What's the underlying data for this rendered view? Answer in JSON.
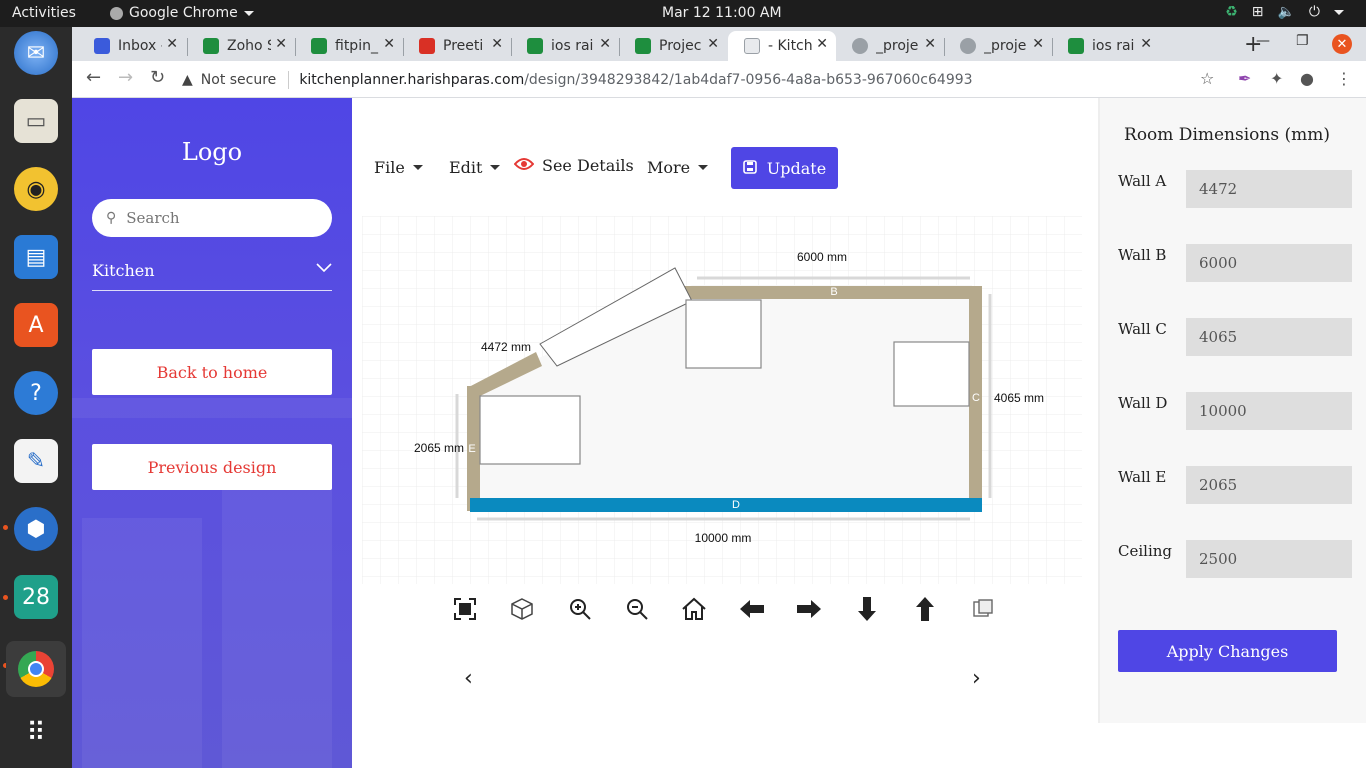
{
  "system": {
    "activities": "Activities",
    "app_name": "Google Chrome",
    "clock": "Mar 12  11:00 AM",
    "calendar_day": "28"
  },
  "browser": {
    "tabs": [
      {
        "label": "Inbox -",
        "color": "#3b5bdb"
      },
      {
        "label": "Zoho S",
        "color": "#1e8e3e"
      },
      {
        "label": "fitpin_",
        "color": "#1e8e3e"
      },
      {
        "label": "Preeti",
        "color": "#d93025"
      },
      {
        "label": "ios rai",
        "color": "#1e8e3e"
      },
      {
        "label": "Projec",
        "color": "#1e8e3e"
      },
      {
        "label": "- Kitch",
        "color": "#5f6368"
      },
      {
        "label": "_proje",
        "color": "#5f6368"
      },
      {
        "label": "_proje",
        "color": "#5f6368"
      },
      {
        "label": "ios rai",
        "color": "#1e8e3e"
      }
    ],
    "security_label": "Not secure",
    "url_host": "kitchenplanner.harishparas.com",
    "url_path": "/design/3948293842/1ab4daf7-0956-4a8a-b653-967060c64993"
  },
  "sidebar": {
    "logo": "Logo",
    "search_placeholder": "Search",
    "category": "Kitchen",
    "back_home": "Back to home",
    "previous_design": "Previous design"
  },
  "designer": {
    "menu": {
      "file": "File",
      "edit": "Edit",
      "see_details": "See Details",
      "more": "More",
      "update": "Update"
    },
    "plan": {
      "dim_b": "6000 mm",
      "dim_a": "4472 mm",
      "dim_c": "4065 mm",
      "dim_e": "2065 mm",
      "dim_d": "10000 mm",
      "label_b": "B",
      "label_c": "C",
      "label_d": "D",
      "label_e": "E",
      "wall_color": "#b5a98c",
      "wall_d_color": "#0a8abf"
    },
    "carousel": {
      "prev": "‹",
      "next": "›"
    }
  },
  "panel": {
    "title": "Room Dimensions (mm)",
    "fields": [
      {
        "label": "Wall A",
        "value": "4472"
      },
      {
        "label": "Wall B",
        "value": "6000"
      },
      {
        "label": "Wall C",
        "value": "4065"
      },
      {
        "label": "Wall D",
        "value": "10000"
      },
      {
        "label": "Wall E",
        "value": "2065"
      },
      {
        "label": "Ceiling",
        "value": "2500"
      }
    ],
    "apply": "Apply Changes"
  }
}
